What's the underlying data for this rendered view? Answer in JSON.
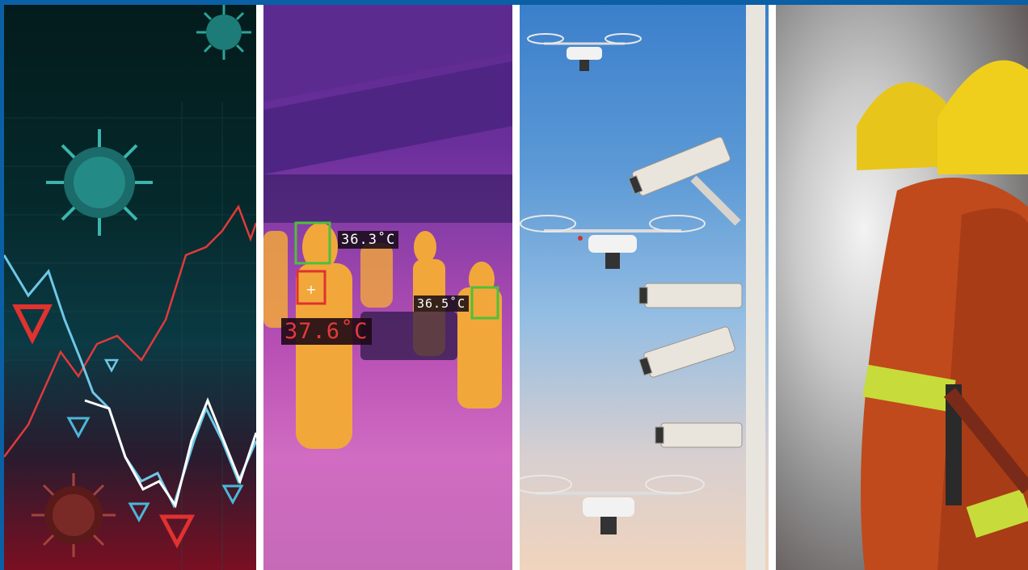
{
  "panels": {
    "thermal": {
      "readings": [
        "36.3˚C",
        "36.5˚C",
        "37.6˚C"
      ]
    }
  }
}
